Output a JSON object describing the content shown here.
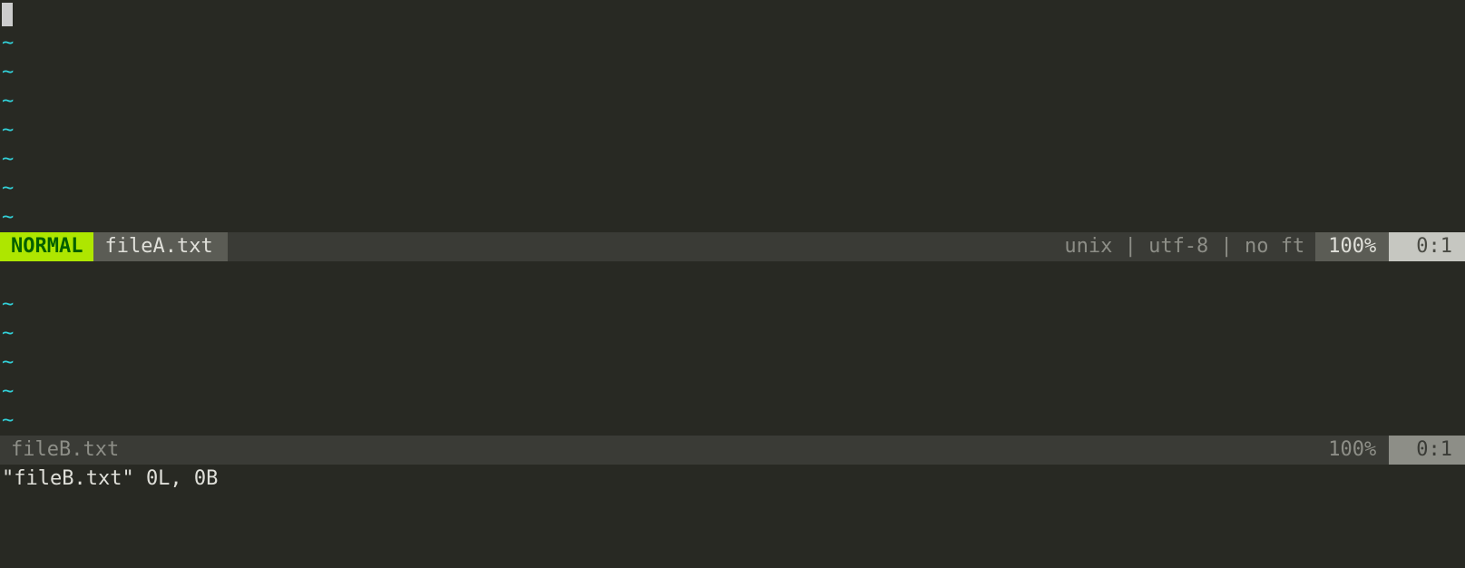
{
  "top_window": {
    "mode": "NORMAL",
    "filename": "fileA.txt",
    "fileinfo": "unix | utf-8 | no ft",
    "percent": "100%",
    "position": "0:1",
    "tilde": "~"
  },
  "bottom_window": {
    "filename": "fileB.txt",
    "percent": "100%",
    "position": "0:1",
    "tilde": "~"
  },
  "command_line": "\"fileB.txt\" 0L, 0B"
}
